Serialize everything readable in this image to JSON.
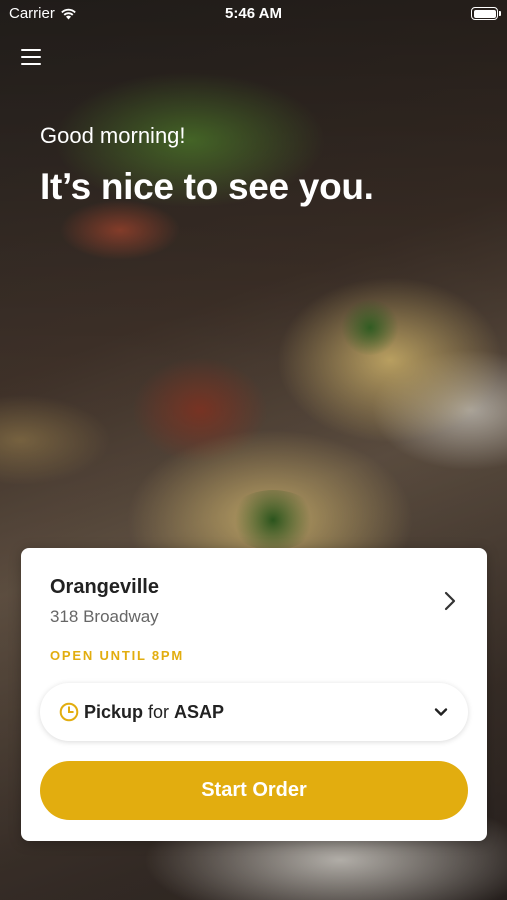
{
  "status_bar": {
    "carrier": "Carrier",
    "time": "5:46 AM"
  },
  "hero": {
    "greeting": "Good morning!",
    "headline": "It’s nice to see you."
  },
  "location": {
    "name": "Orangeville",
    "address": "318 Broadway",
    "hours": "OPEN UNTIL 8PM"
  },
  "order_mode": {
    "mode": "Pickup",
    "connector": "for",
    "time": "ASAP"
  },
  "actions": {
    "start_order": "Start Order"
  },
  "colors": {
    "accent": "#e2ad0f",
    "text_primary": "#222222",
    "text_secondary": "#666666"
  },
  "icons": {
    "menu": "hamburger-menu-icon",
    "wifi": "wifi-icon",
    "battery": "battery-icon",
    "location_chevron": "chevron-right-icon",
    "clock": "clock-icon",
    "dropdown": "chevron-down-icon"
  }
}
